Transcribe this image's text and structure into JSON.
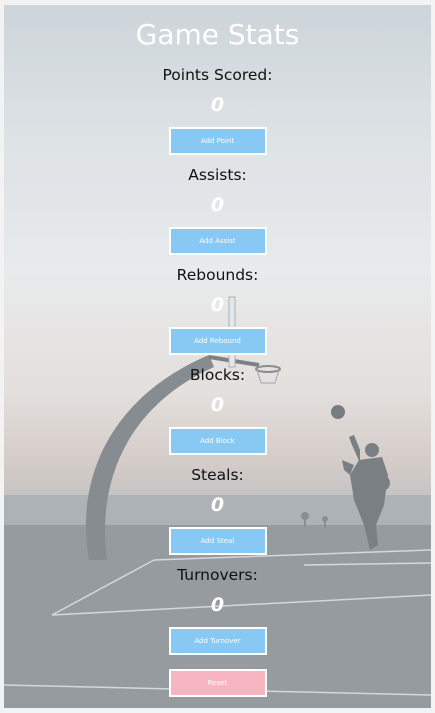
{
  "page": {
    "title": "Game Stats"
  },
  "stats": [
    {
      "label": "Points Scored:",
      "value": "0",
      "button": "Add Point"
    },
    {
      "label": "Assists:",
      "value": "0",
      "button": "Add Assist"
    },
    {
      "label": "Rebounds:",
      "value": "0",
      "button": "Add Rebound"
    },
    {
      "label": "Blocks:",
      "value": "0",
      "button": "Add Block"
    },
    {
      "label": "Steals:",
      "value": "0",
      "button": "Add Steal"
    },
    {
      "label": "Turnovers:",
      "value": "0",
      "button": "Add Turnover"
    }
  ],
  "reset": {
    "label": "Reset"
  },
  "colors": {
    "button": "#87c9f3",
    "reset_button": "#f6b5c0",
    "value_text": "#ffffff"
  }
}
